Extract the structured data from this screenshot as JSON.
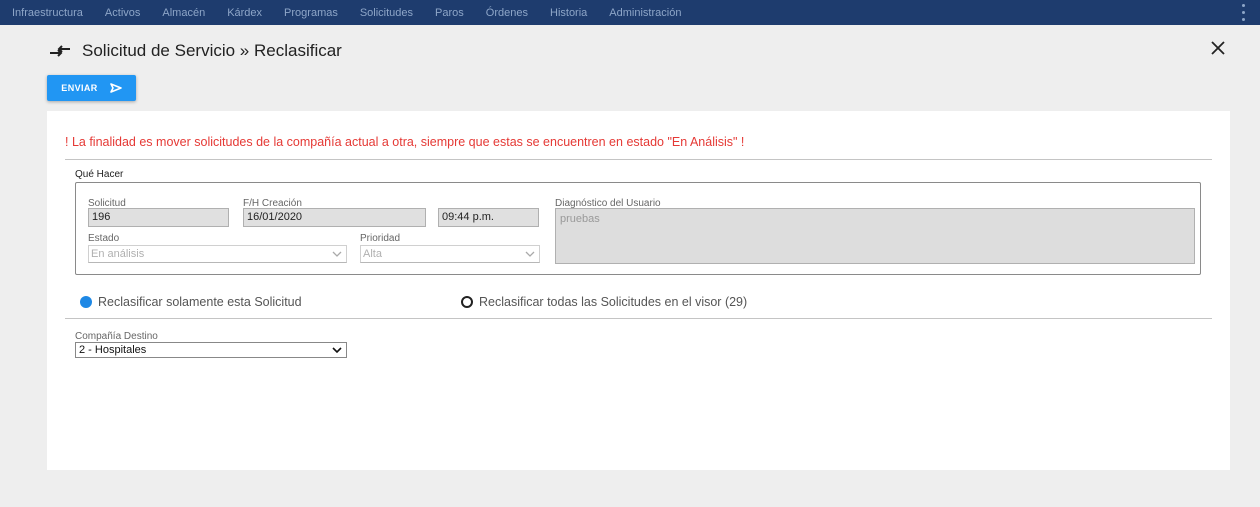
{
  "nav": {
    "items": [
      "Infraestructura",
      "Activos",
      "Almacén",
      "Kárdex",
      "Programas",
      "Solicitudes",
      "Paros",
      "Órdenes",
      "Historia",
      "Administración"
    ]
  },
  "header": {
    "title": "Solicitud de Servicio » Reclasificar"
  },
  "toolbar": {
    "send_label": "ENVIAR"
  },
  "warning": "! La finalidad es mover solicitudes de la compañía actual a otra, siempre que estas se encuentren en estado \"En Análisis\" !",
  "section": {
    "legend": "Qué Hacer",
    "solicitud_label": "Solicitud",
    "solicitud_value": "196",
    "fh_label": "F/H Creación",
    "date_value": "16/01/2020",
    "time_value": "09:44 p.m.",
    "diag_label": "Diagnóstico del Usuario",
    "diag_value": "pruebas",
    "estado_label": "Estado",
    "estado_value": "En análisis",
    "prioridad_label": "Prioridad",
    "prioridad_value": "Alta"
  },
  "options": {
    "single_label": "Reclasificar solamente esta Solicitud",
    "all_label": "Reclasificar todas las Solicitudes en el visor (29)",
    "selected": "single"
  },
  "destination": {
    "label": "Compañía Destino",
    "value": "2 - Hospitales"
  },
  "colors": {
    "nav_bg": "#1e3c6e",
    "accent": "#2196f3",
    "warning": "#e53935"
  }
}
